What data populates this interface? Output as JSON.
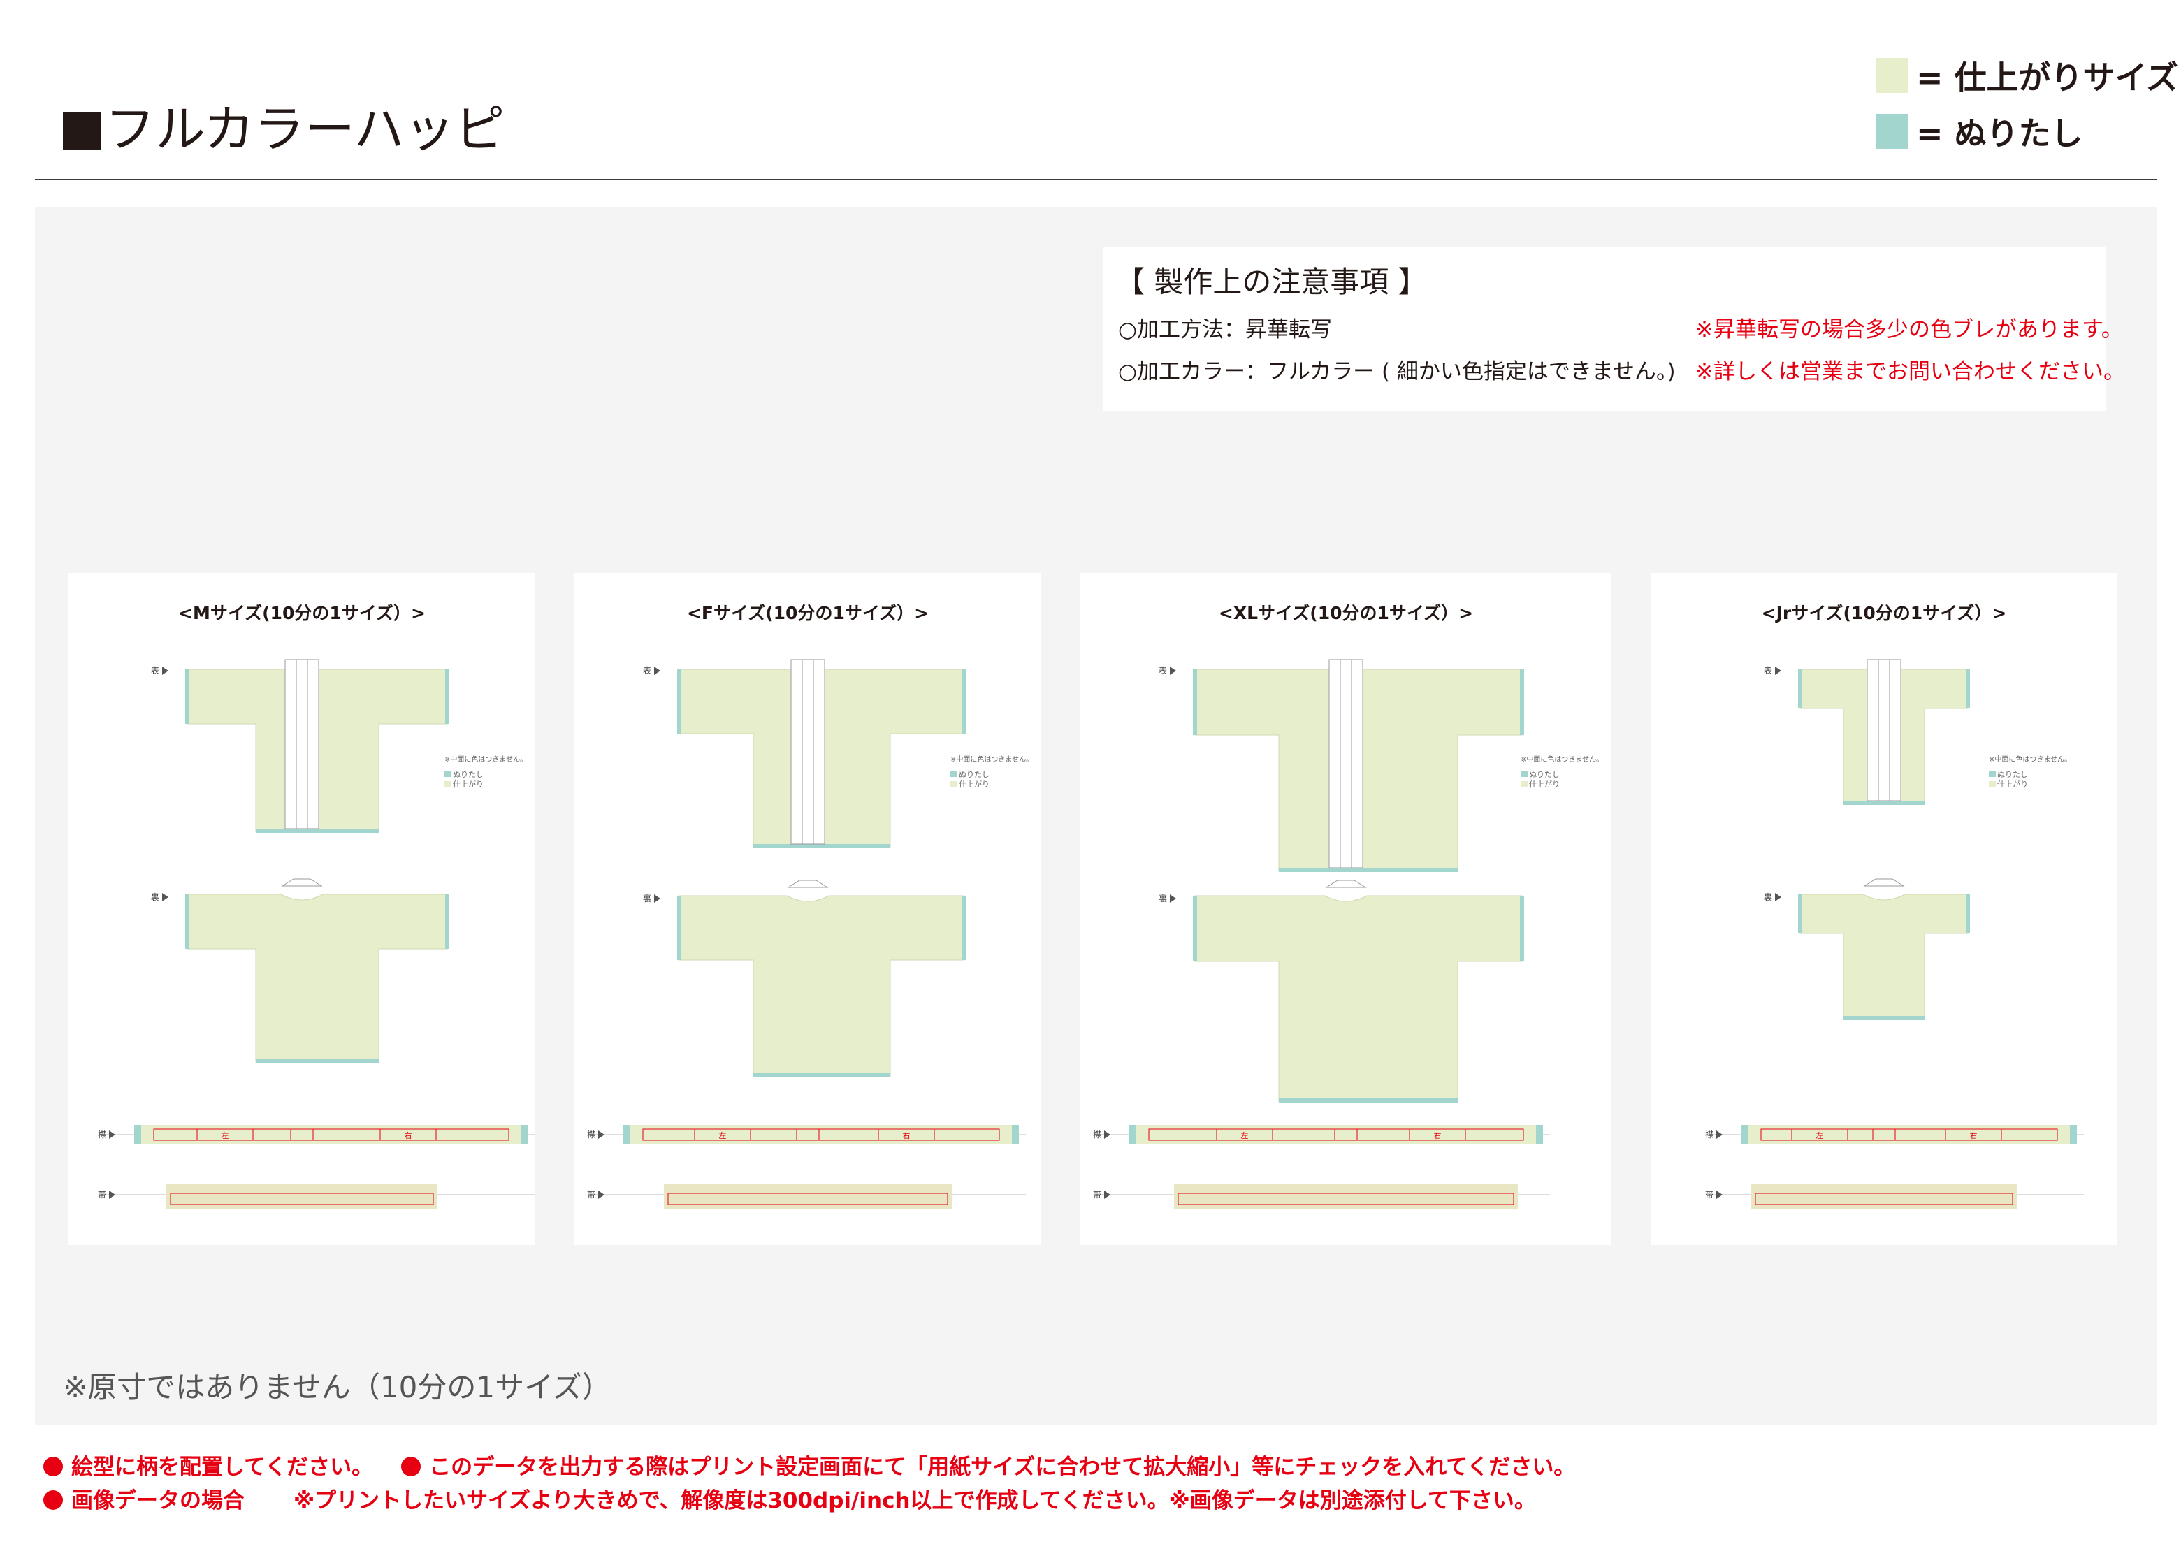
{
  "header": {
    "title": "フルカラーハッピ",
    "legend": [
      {
        "label": "= 仕上がりサイズ",
        "color": "#e6eecb"
      },
      {
        "label": "= ぬりたし",
        "color": "#a2d5cd"
      }
    ]
  },
  "notes": {
    "title": "【 製作上の注意事項 】",
    "left": [
      "○加工方法：昇華転写",
      "○加工カラー：フルカラー ( 細かい色指定はできません。)"
    ],
    "right": [
      "※昇華転写の場合多少の色ブレがあります。",
      "※詳しくは営業までお問い合わせください。"
    ]
  },
  "cards": [
    {
      "title": "<Mサイズ(10分の1サイズ）>"
    },
    {
      "title": "<Fサイズ(10分の1サイズ）>"
    },
    {
      "title": "<XLサイズ(10分の1サイズ）>"
    },
    {
      "title": "<Jrサイズ(10分の1サイズ）>"
    }
  ],
  "labels": {
    "front": "表",
    "back": "裏",
    "collar": "襟",
    "belt": "帯",
    "note": "※中面に色はつきません。",
    "bleed": "ぬりたし",
    "finish": "仕上がり",
    "left": "左",
    "right": "右"
  },
  "colors": {
    "finish": "#e6eecb",
    "bleed": "#a2d5cd",
    "belt": "#e9e6c4",
    "cut": "#e60012"
  },
  "footnote": "※原寸ではありません（10分の1サイズ）",
  "bottom": {
    "line1a": "絵型に柄を配置してください。",
    "line1b": "このデータを出力する際はプリント設定画面にて「用紙サイズに合わせて拡大縮小」等にチェックを入れてください。",
    "line2a": "画像データの場合",
    "line2b": "※プリントしたいサイズより大きめで、解像度は300dpi/inch以上で作成してください。※画像データは別途添付して下さい。"
  }
}
